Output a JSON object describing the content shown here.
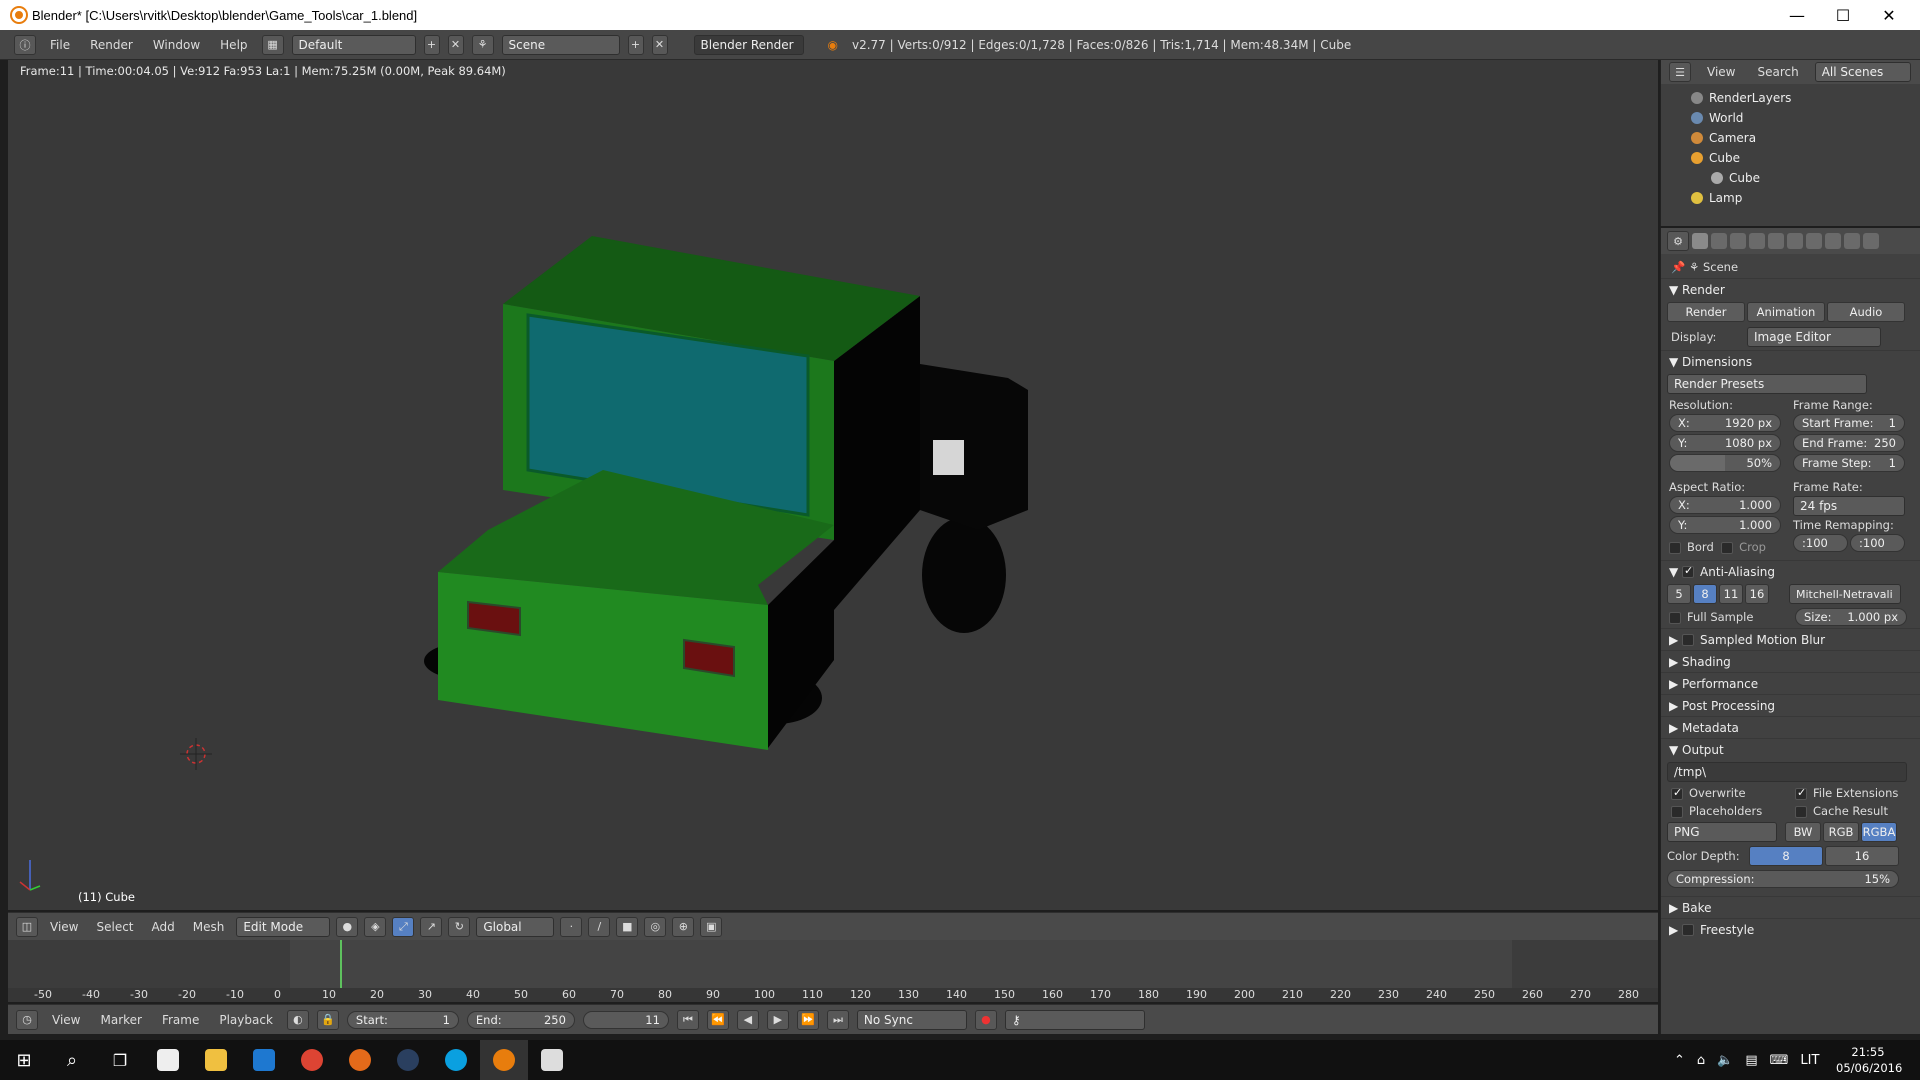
{
  "window": {
    "title": "Blender* [C:\\Users\\rvitk\\Desktop\\blender\\Game_Tools\\car_1.blend]"
  },
  "info": {
    "menus": [
      "File",
      "Render",
      "Window",
      "Help"
    ],
    "layout": "Default",
    "scene": "Scene",
    "engine": "Blender Render",
    "stats": "v2.77 | Verts:0/912 | Edges:0/1,728 | Faces:0/826 | Tris:1,714 | Mem:48.34M | Cube"
  },
  "viewport": {
    "frame_info": "Frame:11 | Time:00:04.05 | Ve:912 Fa:953 La:1 | Mem:75.25M (0.00M, Peak 89.64M)",
    "object_label": "(11) Cube",
    "colors": {
      "body": "#1e7a1e",
      "window": "#1a7a80",
      "dark": "#050505",
      "light": "#c04040",
      "bg": "#393939"
    }
  },
  "vp_header": {
    "menus": [
      "View",
      "Select",
      "Add",
      "Mesh"
    ],
    "mode": "Edit Mode",
    "orientation": "Global"
  },
  "timeline": {
    "ticks": [
      "-50",
      "-40",
      "-30",
      "-20",
      "-10",
      "0",
      "10",
      "20",
      "30",
      "40",
      "50",
      "60",
      "70",
      "80",
      "90",
      "100",
      "110",
      "120",
      "130",
      "140",
      "150",
      "160",
      "170",
      "180",
      "190",
      "200",
      "210",
      "220",
      "230",
      "240",
      "250",
      "260",
      "270",
      "280"
    ],
    "menus": [
      "View",
      "Marker",
      "Frame",
      "Playback"
    ],
    "start_label": "Start:",
    "start": "1",
    "end_label": "End:",
    "end": "250",
    "current": "11",
    "sync": "No Sync"
  },
  "outliner": {
    "menus": [
      "View",
      "Search"
    ],
    "filter": "All Scenes",
    "items": [
      {
        "label": "RenderLayers",
        "icon": "render-layers-icon"
      },
      {
        "label": "World",
        "icon": "world-icon"
      },
      {
        "label": "Camera",
        "icon": "camera-icon"
      },
      {
        "label": "Cube",
        "icon": "mesh-object-icon"
      },
      {
        "label": "Cube",
        "icon": "mesh-data-icon"
      },
      {
        "label": "Lamp",
        "icon": "lamp-icon"
      }
    ]
  },
  "props": {
    "context": "Scene",
    "render_panel": "Render",
    "render_buttons": [
      "Render",
      "Animation",
      "Audio"
    ],
    "display_label": "Display:",
    "display_value": "Image Editor",
    "dimensions": "Dimensions",
    "presets": "Render Presets",
    "resolution_label": "Resolution:",
    "res_x_label": "X:",
    "res_x": "1920 px",
    "res_y_label": "Y:",
    "res_y": "1080 px",
    "res_pct": "50%",
    "frame_range_label": "Frame Range:",
    "start_frame_label": "Start Frame:",
    "start_frame": "1",
    "end_frame_label": "End Frame:",
    "end_frame": "250",
    "frame_step_label": "Frame Step:",
    "frame_step": "1",
    "aspect_label": "Aspect Ratio:",
    "aspect_x_label": "X:",
    "aspect_x": "1.000",
    "aspect_y_label": "Y:",
    "aspect_y": "1.000",
    "frame_rate_label": "Frame Rate:",
    "frame_rate": "24 fps",
    "time_remap_label": "Time Remapping:",
    "remap_old": ":100",
    "remap_new": ":100",
    "bord": "Bord",
    "crop": "Crop",
    "aa": "Anti-Aliasing",
    "aa_samples": [
      "5",
      "8",
      "11",
      "16"
    ],
    "aa_filter": "Mitchell-Netravali",
    "full_sample": "Full Sample",
    "size_label": "Size:",
    "size": "1.000 px",
    "collapsed": [
      "Sampled Motion Blur",
      "Shading",
      "Performance",
      "Post Processing",
      "Metadata"
    ],
    "output": "Output",
    "output_path": "/tmp\\",
    "overwrite": "Overwrite",
    "file_ext": "File Extensions",
    "placeholders": "Placeholders",
    "cache_result": "Cache Result",
    "format": "PNG",
    "color_modes": [
      "BW",
      "RGB",
      "RGBA"
    ],
    "color_depth_label": "Color Depth:",
    "depth_options": [
      "8",
      "16"
    ],
    "compression_label": "Compression:",
    "compression": "15%",
    "bake": "Bake",
    "freestyle": "Freestyle"
  },
  "taskbar": {
    "clock": "21:55",
    "date": "05/06/2016",
    "lang": "LIT"
  }
}
